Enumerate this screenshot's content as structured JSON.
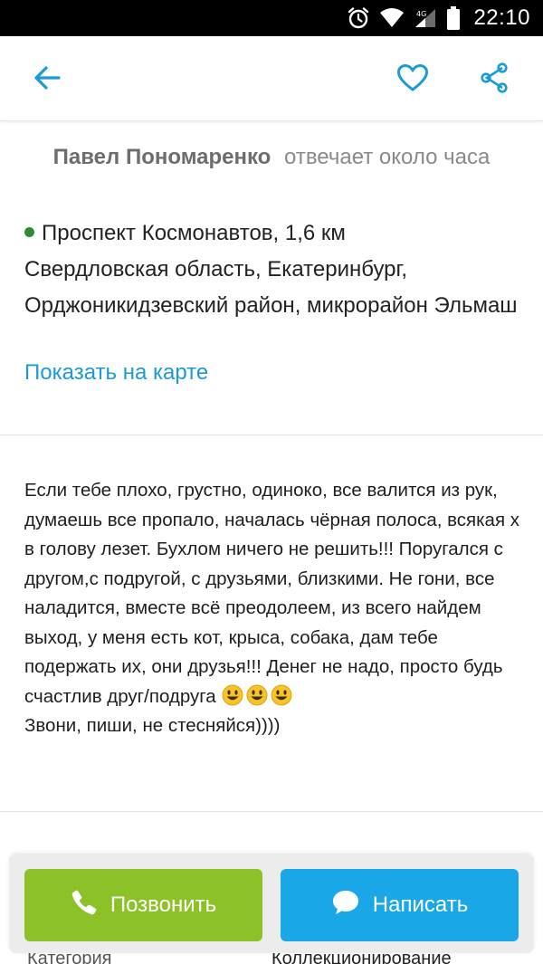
{
  "status_bar": {
    "time": "22:10",
    "icons": [
      "alarm-icon",
      "wifi-icon",
      "signal-icon",
      "battery-icon"
    ]
  },
  "app_bar": {
    "icons": [
      "back-arrow-icon",
      "heart-icon",
      "share-icon"
    ],
    "accent_color": "#1a9ad6"
  },
  "seller": {
    "name": "Павел Пономаренко",
    "response": "отвечает около часа"
  },
  "address": {
    "metro": "Проспект Космонавтов, 1,6 км",
    "full": "Свердловская область, Екатеринбург, Орджоникидзевский район, микрорайон Эльмаш",
    "map_link": "Показать на карте",
    "metro_color": "#2e8b3a"
  },
  "description": {
    "text": "Если тебе плохо, грустно, одиноко, все валится из рук, думаешь все пропало, началась чёрная полоса, всякая х в голову лезет. Бухлом ничего не решить!!! Поругался с другом,с подругой, с друзьями, близкими. Не гони, все наладится, вместе всё преодолеем, из всего найдем выход, у меня есть кот, крыса, собака, дам тебе подержать их, они друзья!!! Денег не надо, просто будь счастлив друг/подруга",
    "emoji": "😃😃😃",
    "closing": "Звони, пиши, не стесняйся))))"
  },
  "details": {
    "category_label": "Категория",
    "category_value": "Коллекционирование"
  },
  "actions": {
    "call_label": "Позвонить",
    "message_label": "Написать",
    "call_color": "#8cc227",
    "message_color": "#1aa7e8"
  }
}
